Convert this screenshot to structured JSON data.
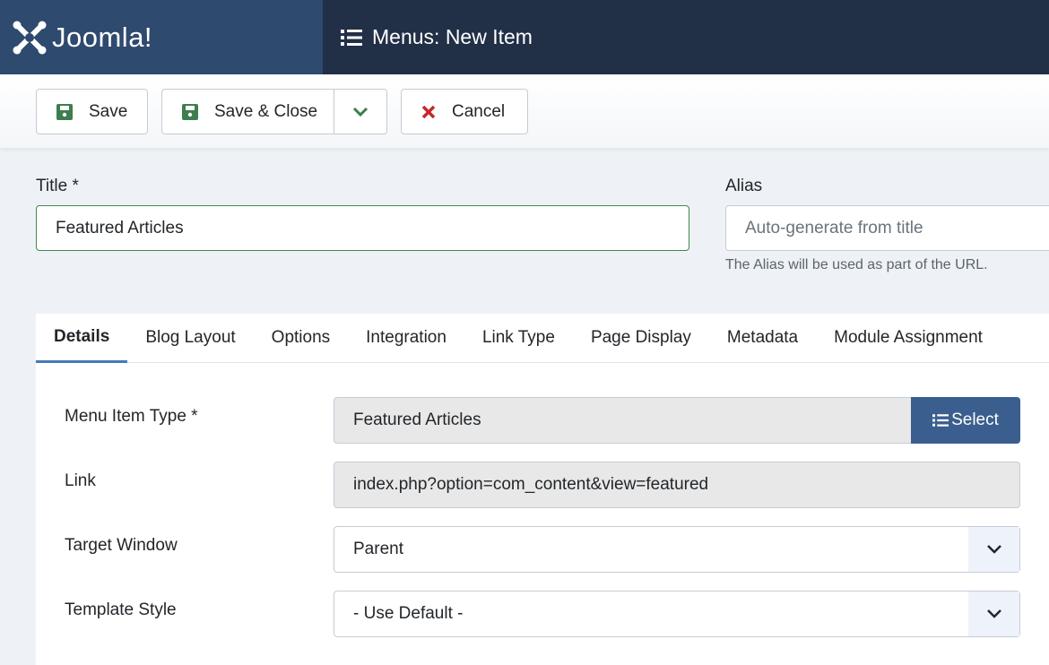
{
  "header": {
    "logo_text": "Joomla!",
    "title": "Menus: New Item"
  },
  "toolbar": {
    "save": "Save",
    "save_close": "Save & Close",
    "cancel": "Cancel"
  },
  "form": {
    "title_label": "Title *",
    "title_value": "Featured Articles",
    "alias_label": "Alias",
    "alias_placeholder": "Auto-generate from title",
    "alias_hint": "The Alias will be used as part of the URL."
  },
  "tabs": [
    "Details",
    "Blog Layout",
    "Options",
    "Integration",
    "Link Type",
    "Page Display",
    "Metadata",
    "Module Assignment"
  ],
  "details": {
    "menu_item_type_label": "Menu Item Type *",
    "menu_item_type_value": "Featured Articles",
    "select_label": "Select",
    "link_label": "Link",
    "link_value": "index.php?option=com_content&view=featured",
    "target_label": "Target Window",
    "target_value": "Parent",
    "template_label": "Template Style",
    "template_value": "- Use Default -"
  },
  "colors": {
    "accent": "#3a5f8e",
    "save_icon": "#3d7d4e",
    "cancel_icon": "#c52827"
  }
}
